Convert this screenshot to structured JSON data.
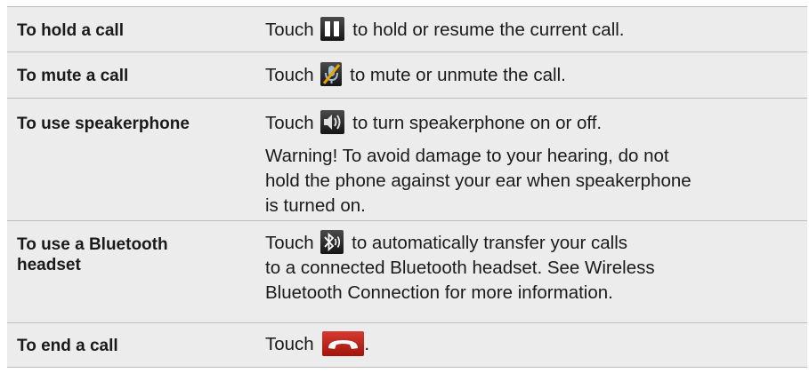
{
  "rows": [
    {
      "label": "To hold a call",
      "desc_before": "Touch",
      "icon": "pause-icon",
      "desc_after": "to hold or resume the current call."
    },
    {
      "label": "To mute a call",
      "desc_before": "Touch",
      "icon": "microphone-mute-icon",
      "desc_after": "to mute or unmute the call."
    },
    {
      "label": "To use speakerphone",
      "desc_before": "Touch",
      "icon": "speaker-icon",
      "desc_after": "to turn speakerphone on or off.",
      "warning": {
        "line1": "Warning! To avoid damage to your hearing, do not",
        "line2": "hold the phone against your ear when speakerphone",
        "line3": "is turned on."
      }
    },
    {
      "label_line1": "To use a Bluetooth",
      "label_line2": "headset",
      "desc_before": "Touch",
      "icon": "bluetooth-audio-icon",
      "desc_after": "to automatically transfer your calls",
      "desc_line2": "to a connected Bluetooth headset. See Wireless",
      "desc_line3": "Bluetooth Connection for more information."
    },
    {
      "label": "To end a call",
      "desc_before": "Touch",
      "icon": "end-call-icon",
      "desc_after": "."
    }
  ],
  "colors": {
    "row_background": "#ececec",
    "divider": "#bdbdbd",
    "end_call_red": "#c8281e"
  }
}
